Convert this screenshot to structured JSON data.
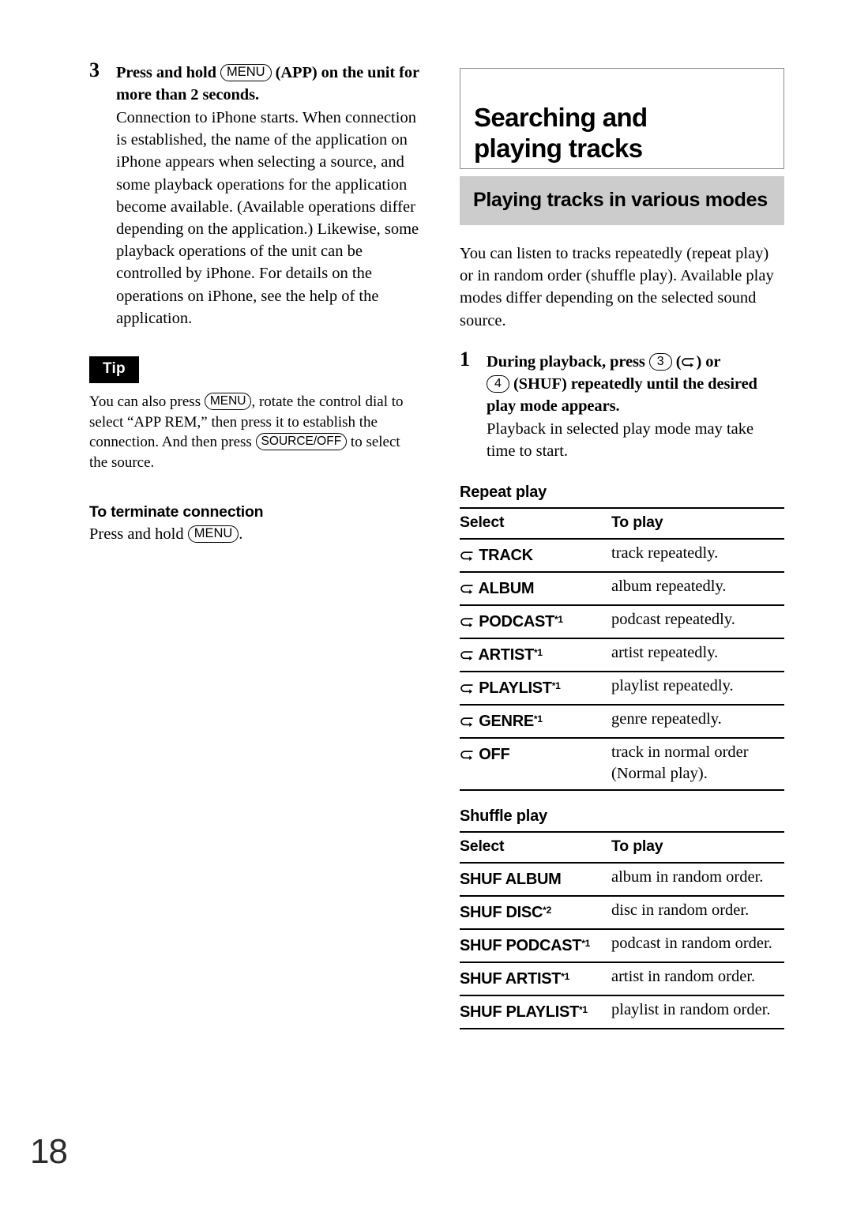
{
  "page": {
    "number": "18"
  },
  "left_column": {
    "step": {
      "number": "3",
      "heading_part1": "Press and hold",
      "heading_key": "MENU",
      "heading_part2": "(APP) on the unit for more than 2 seconds.",
      "body": "Connection to iPhone starts. When connection is established, the name of the application on iPhone appears when selecting a source, and some playback operations for the application become available. (Available operations differ depending on the application.) Likewise, some playback operations of the unit can be controlled by iPhone. For details on the operations on iPhone, see the help of the application."
    },
    "tip": {
      "badge": "Tip",
      "text_part1": "You can also press",
      "key1": "MENU",
      "text_part2": ", rotate the control dial to select “APP REM,” then press it to establish the connection. And then press",
      "key2": "SOURCE/OFF",
      "text_part3": "to select the source."
    },
    "terminate": {
      "heading": "To terminate connection",
      "text_part1": "Press and hold",
      "key": "MENU",
      "text_part2": "."
    }
  },
  "right_column": {
    "chapter_title_line1": "Searching and",
    "chapter_title_line2": "playing tracks",
    "section_title": "Playing tracks in various modes",
    "intro": "You can listen to tracks repeatedly (repeat play) or in random order (shuffle play). Available play modes differ depending on the selected sound source.",
    "step": {
      "number": "1",
      "heading_part1": "During playback, press",
      "key_num1": "3",
      "heading_part2": "(",
      "heading_part3": ") or",
      "key_num2": "4",
      "heading_part4": "(SHUF) repeatedly until the desired play mode appears.",
      "body": "Playback in selected play mode may take time to start."
    },
    "repeat_table": {
      "title": "Repeat play",
      "columns": [
        "Select",
        "To play"
      ],
      "rows": [
        {
          "icon": "repeat-loop-icon",
          "select": "TRACK",
          "footnote": "",
          "play": "track repeatedly."
        },
        {
          "icon": "repeat-loop-icon",
          "select": "ALBUM",
          "footnote": "",
          "play": "album repeatedly."
        },
        {
          "icon": "repeat-loop-icon",
          "select": "PODCAST",
          "footnote": "*1",
          "play": "podcast repeatedly."
        },
        {
          "icon": "repeat-loop-icon",
          "select": "ARTIST",
          "footnote": "*1",
          "play": "artist repeatedly."
        },
        {
          "icon": "repeat-loop-icon",
          "select": "PLAYLIST",
          "footnote": "*1",
          "play": "playlist repeatedly."
        },
        {
          "icon": "repeat-loop-icon",
          "select": "GENRE",
          "footnote": "*1",
          "play": "genre repeatedly."
        },
        {
          "icon": "repeat-loop-icon",
          "select": "OFF",
          "footnote": "",
          "play": "track in normal order (Normal play)."
        }
      ]
    },
    "shuffle_table": {
      "title": "Shuffle play",
      "columns": [
        "Select",
        "To play"
      ],
      "rows": [
        {
          "select": "SHUF ALBUM",
          "footnote": "",
          "play": "album in random order."
        },
        {
          "select": "SHUF DISC",
          "footnote": "*2",
          "play": "disc in random order."
        },
        {
          "select": "SHUF PODCAST",
          "footnote": "*1",
          "play": "podcast in random order."
        },
        {
          "select": "SHUF ARTIST",
          "footnote": "*1",
          "play": "artist in random order."
        },
        {
          "select": "SHUF PLAYLIST",
          "footnote": "*1",
          "play": "playlist in random order."
        }
      ]
    }
  },
  "colors": {
    "section_band": "#cccccc",
    "rule": "#000000",
    "tip_badge_bg": "#000000"
  }
}
